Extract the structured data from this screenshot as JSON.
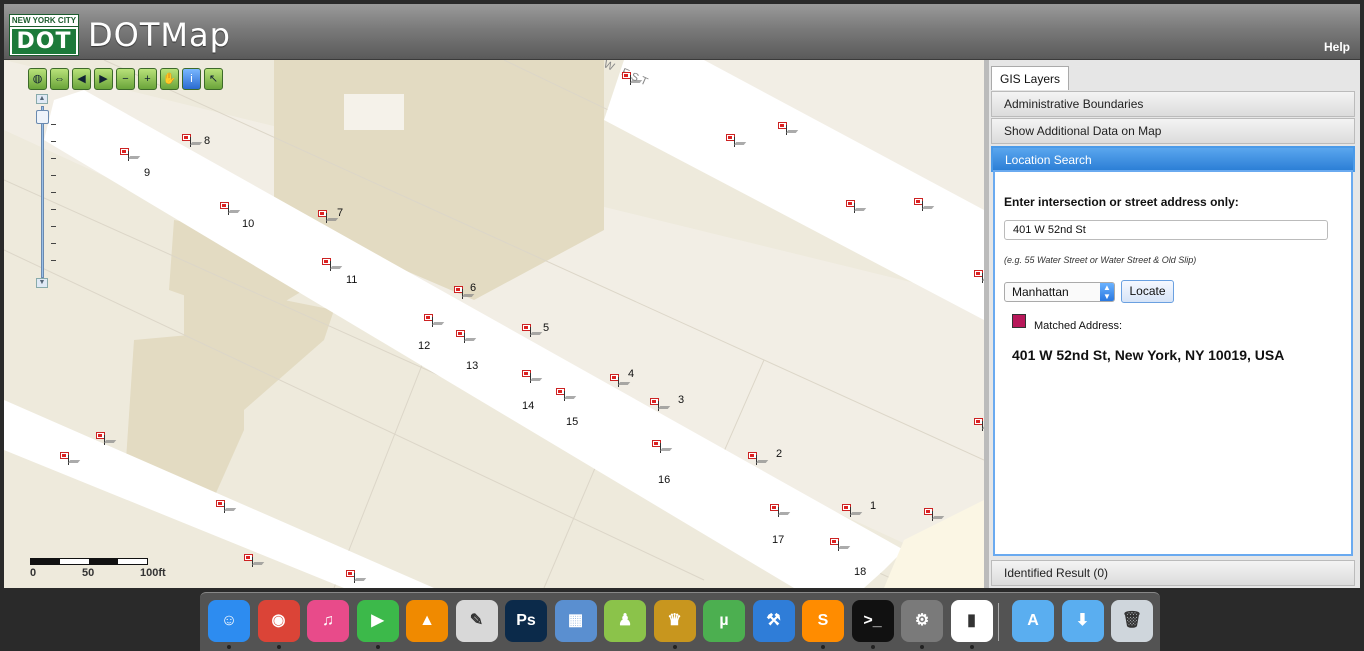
{
  "header": {
    "logo_top": "NEW YORK CITY",
    "logo_bottom": "DOT",
    "app_title": "DOTMap",
    "help": "Help"
  },
  "map": {
    "street_label": "W EST",
    "toolbar_icons": [
      "globe-icon",
      "measure-icon",
      "pan-back-icon",
      "pan-forward-icon",
      "zoom-out-icon",
      "zoom-in-icon",
      "hand-icon",
      "info-icon",
      "select-icon"
    ],
    "pins": [
      {
        "label": "1"
      },
      {
        "label": "2"
      },
      {
        "label": "3"
      },
      {
        "label": "4"
      },
      {
        "label": "5"
      },
      {
        "label": "6"
      },
      {
        "label": "7"
      },
      {
        "label": "8"
      },
      {
        "label": "9"
      },
      {
        "label": "10"
      },
      {
        "label": "11"
      },
      {
        "label": "12"
      },
      {
        "label": "13"
      },
      {
        "label": "14"
      },
      {
        "label": "15"
      },
      {
        "label": "16"
      },
      {
        "label": "17"
      },
      {
        "label": "18"
      }
    ],
    "scale_labels": [
      "0",
      "50",
      "100ft"
    ]
  },
  "sidebar": {
    "tab": "GIS Layers",
    "sections": {
      "admin": "Administrative Boundaries",
      "additional": "Show Additional Data on Map",
      "location": "Location Search"
    },
    "search": {
      "instruction": "Enter intersection or street address only:",
      "value": "401 W 52nd St",
      "hint": "(e.g. 55 Water Street or Water Street & Old Slip)",
      "borough": "Manhattan",
      "locate_label": "Locate",
      "matched_label": "Matched Address:",
      "matched_address": "401 W 52nd St, New York, NY 10019, USA",
      "legend_color": "#b8185a"
    },
    "identified": "Identified Result (0)"
  },
  "dock": {
    "apps": [
      {
        "name": "finder-icon",
        "glyph": "☺",
        "color": "#2d8cf0"
      },
      {
        "name": "chrome-icon",
        "glyph": "◉",
        "color": "#db4437"
      },
      {
        "name": "itunes-icon",
        "glyph": "♫",
        "color": "#e84b8a"
      },
      {
        "name": "facetime-icon",
        "glyph": "▶",
        "color": "#3cb94a"
      },
      {
        "name": "vlc-icon",
        "glyph": "▲",
        "color": "#f08a00"
      },
      {
        "name": "textedit-icon",
        "glyph": "✎",
        "color": "#d8d8d8"
      },
      {
        "name": "photoshop-icon",
        "glyph": "Ps",
        "color": "#0b2a4a"
      },
      {
        "name": "preview-icon",
        "glyph": "▦",
        "color": "#5a8fd0"
      },
      {
        "name": "android-icon",
        "glyph": "♟",
        "color": "#8bc34a"
      },
      {
        "name": "crown-app-icon",
        "glyph": "♛",
        "color": "#c8961e"
      },
      {
        "name": "utorrent-icon",
        "glyph": "µ",
        "color": "#4caf50"
      },
      {
        "name": "xcode-icon",
        "glyph": "⚒",
        "color": "#2f7dd8"
      },
      {
        "name": "sublime-icon",
        "glyph": "S",
        "color": "#ff8c00"
      },
      {
        "name": "terminal-icon",
        "glyph": ">_",
        "color": "#111111"
      },
      {
        "name": "system-prefs-icon",
        "glyph": "⚙",
        "color": "#7a7a7a"
      },
      {
        "name": "activity-monitor-icon",
        "glyph": "▮",
        "color": "#ffffff"
      },
      {
        "name": "applications-folder-icon",
        "glyph": "A",
        "color": "#5aaef0"
      },
      {
        "name": "downloads-folder-icon",
        "glyph": "⬇",
        "color": "#5aaef0"
      },
      {
        "name": "trash-icon",
        "glyph": "🗑",
        "color": "#cfd6dc"
      }
    ]
  }
}
